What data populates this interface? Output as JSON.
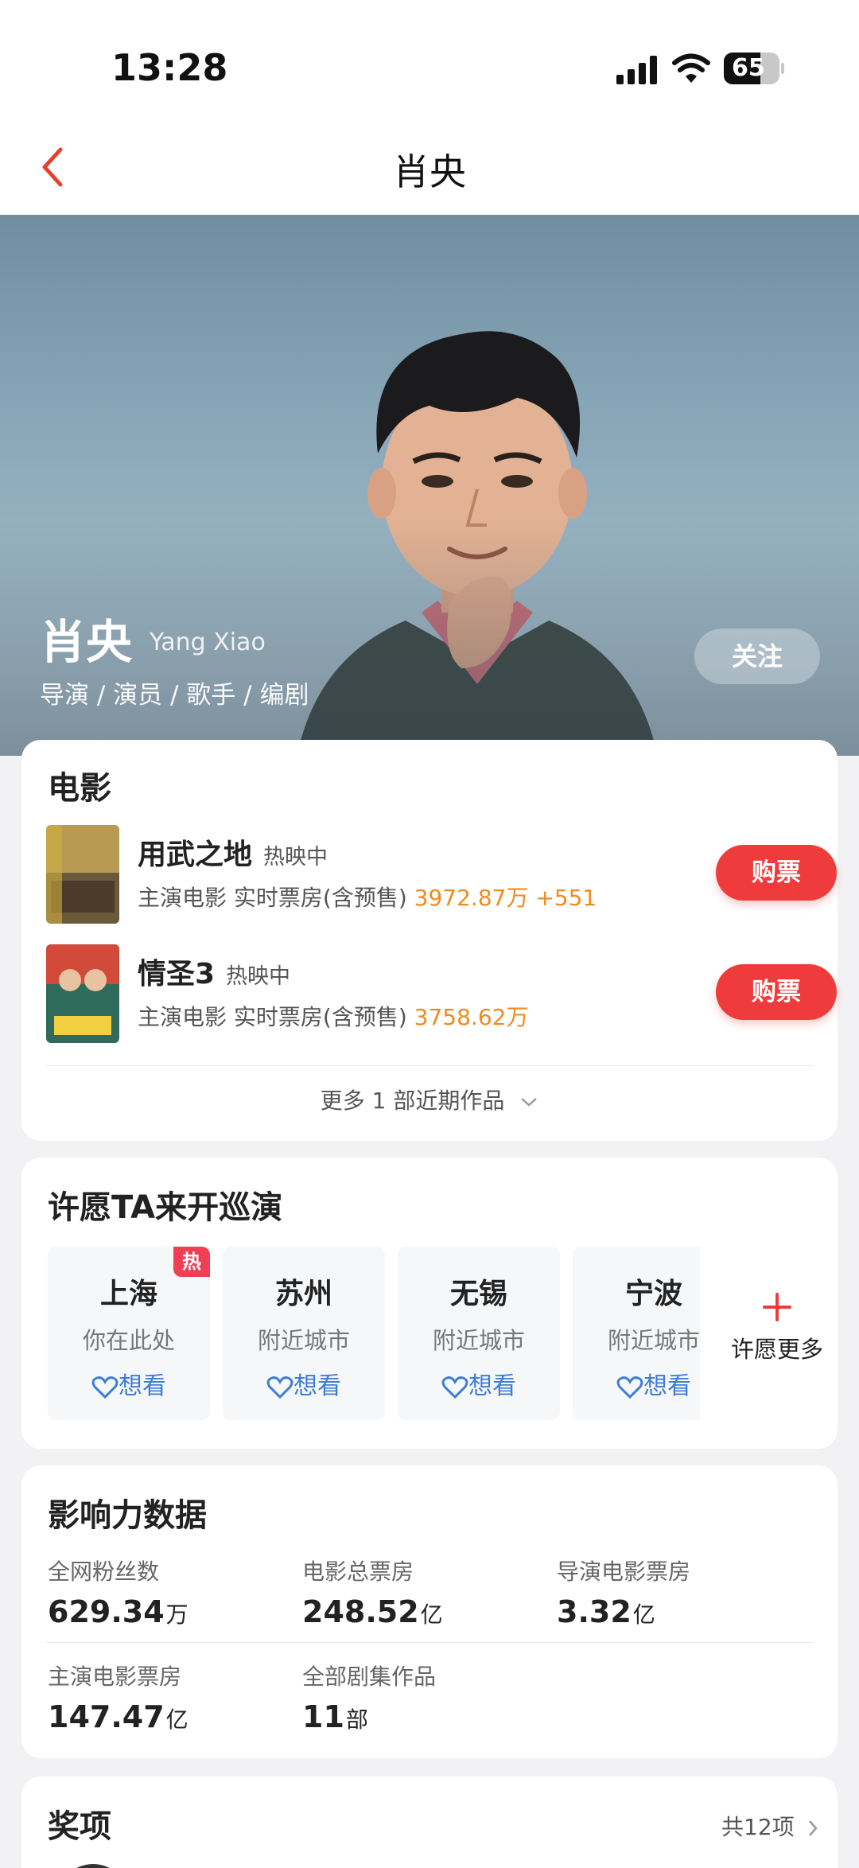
{
  "status_bar": {
    "time": "13:28",
    "battery": "65",
    "battery_level": 0.65
  },
  "nav": {
    "title": "肖央"
  },
  "hero": {
    "name": "肖央",
    "name_en": "Yang Xiao",
    "roles": "导演 / 演员 / 歌手 / 编剧",
    "follow_label": "关注"
  },
  "films": {
    "title": "电影",
    "items": [
      {
        "name": "用武之地",
        "status": "热映中",
        "meta": "主演电影 实时票房(含预售) ",
        "box": "3972.87万 +551",
        "buy_label": "购票",
        "poster_colors": [
          "#a68a4a",
          "#3a3a2a"
        ]
      },
      {
        "name": "情圣3",
        "status": "热映中",
        "meta": "主演电影 实时票房(含预售) ",
        "box": "3758.62万",
        "buy_label": "购票",
        "poster_colors": [
          "#d24a3a",
          "#2f6b5a"
        ]
      }
    ],
    "more_label": "更多 1 部近期作品"
  },
  "tour": {
    "title": "许愿TA来开巡演",
    "cities": [
      {
        "name": "上海",
        "sub": "你在此处",
        "want": "想看",
        "hot": "热"
      },
      {
        "name": "苏州",
        "sub": "附近城市",
        "want": "想看"
      },
      {
        "name": "无锡",
        "sub": "附近城市",
        "want": "想看"
      },
      {
        "name": "宁波",
        "sub": "附近城市",
        "want": "想看"
      }
    ],
    "more_label": "许愿更多"
  },
  "stats": {
    "title": "影响力数据",
    "items": [
      {
        "label": "全网粉丝数",
        "value": "629.34",
        "unit": "万"
      },
      {
        "label": "电影总票房",
        "value": "248.52",
        "unit": "亿"
      },
      {
        "label": "导演电影票房",
        "value": "3.32",
        "unit": "亿"
      },
      {
        "label": "主演电影票房",
        "value": "147.47",
        "unit": "亿"
      },
      {
        "label": "全部剧集作品",
        "value": "11",
        "unit": "部"
      }
    ]
  },
  "awards": {
    "title": "奖项",
    "count_label": "共12项"
  },
  "colors": {
    "accent": "#ef3b3b",
    "box_office": "#f28a1d",
    "want": "#3b7dd8"
  }
}
